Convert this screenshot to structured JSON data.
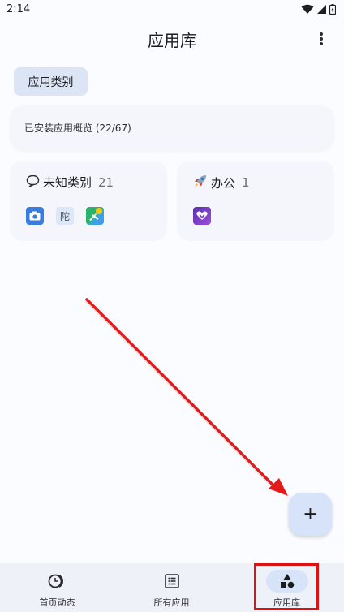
{
  "status_bar": {
    "time": "2:14"
  },
  "app_bar": {
    "title": "应用库"
  },
  "chip": {
    "label": "应用类别"
  },
  "overview": {
    "text": "已安装应用概览 (22/67)"
  },
  "categories": [
    {
      "icon": "speech-bubble-icon",
      "name": "未知类别",
      "count": "21",
      "apps": [
        {
          "icon": "camera-app-icon",
          "color": "#3a7de0"
        },
        {
          "icon": "text-app-icon",
          "label": "陀",
          "color": "#dce7f7"
        },
        {
          "icon": "map-app-icon",
          "color": "#2ab36a"
        }
      ]
    },
    {
      "icon": "rocket-icon",
      "name": "办公",
      "count": "1",
      "apps": [
        {
          "icon": "heart-app-icon",
          "color": "#7b3fc4"
        }
      ]
    }
  ],
  "fab": {
    "label": "+"
  },
  "bottom_nav": [
    {
      "label": "首页动态",
      "icon": "activity-icon",
      "active": false
    },
    {
      "label": "所有应用",
      "icon": "list-icon",
      "active": false
    },
    {
      "label": "应用库",
      "icon": "shapes-icon",
      "active": true
    }
  ],
  "colors": {
    "accent_container": "#d6e3f8",
    "highlight": "#e01010",
    "arrow": "#e41b1b"
  }
}
